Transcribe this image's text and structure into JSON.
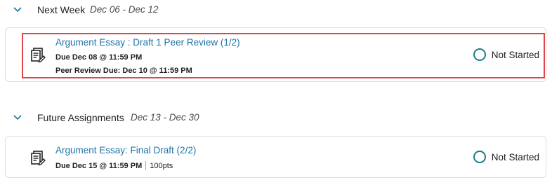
{
  "sections": [
    {
      "title": "Next Week",
      "date_range": "Dec 06 - Dec 12",
      "assignments": [
        {
          "title": "Argument Essay : Draft 1 Peer Review (1/2)",
          "due": "Due Dec 08 @ 11:59 PM",
          "peer_review_due": "Peer Review Due: Dec 10 @ 11:59 PM",
          "status": "Not Started",
          "icon": "assignment-doc-icon"
        }
      ]
    },
    {
      "title": "Future Assignments",
      "date_range": "Dec 13 - Dec 30",
      "assignments": [
        {
          "title": "Argument Essay: Final Draft (2/2)",
          "due": "Due Dec 15 @ 11:59 PM",
          "points": "100pts",
          "status": "Not Started",
          "icon": "assignment-doc-icon"
        }
      ]
    }
  ],
  "colors": {
    "link": "#1f74a7",
    "status_ring": "#1f7a8c",
    "highlight": "#e0474c",
    "card_border": "#dcdfe2"
  }
}
